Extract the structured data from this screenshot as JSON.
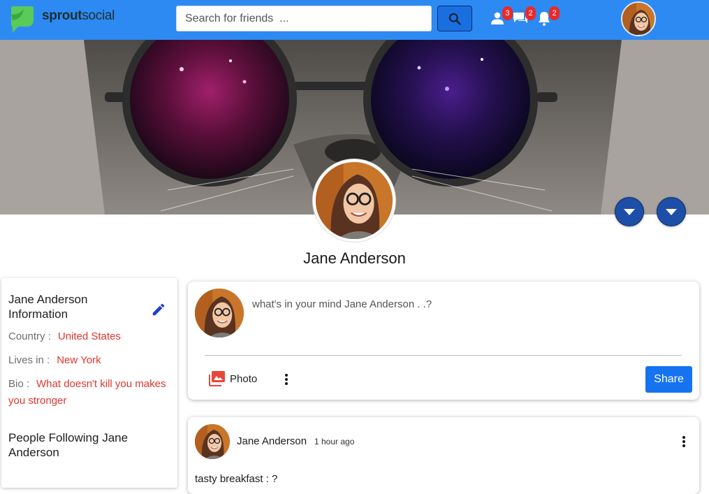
{
  "brand": {
    "name_bold": "sprout",
    "name_light": "social",
    "color": "#59cb59"
  },
  "header": {
    "search_placeholder": "Search for friends  ...",
    "friends_count": "3",
    "messages_count": "2",
    "notifications_count": "2"
  },
  "colors": {
    "nav": "#2d8af3",
    "accent": "#1673f0",
    "badge": "#e82a2a",
    "highlight": "#e0362f"
  },
  "profile": {
    "name": "Jane Anderson"
  },
  "info": {
    "title": "Jane Anderson Information",
    "country_label": "Country :",
    "country_value": "United States",
    "lives_label": "Lives in :",
    "lives_value": "New York",
    "bio_label": "Bio :",
    "bio_value": "What doesn't kill you makes you stronger",
    "followers_title": "People Following Jane Anderson"
  },
  "composer": {
    "placeholder": "what's in your mind Jane Anderson . .?",
    "photo_label": "Photo",
    "share_label": "Share"
  },
  "post": {
    "author": "Jane Anderson",
    "time": "1 hour ago",
    "text": "tasty breakfast : ?"
  }
}
